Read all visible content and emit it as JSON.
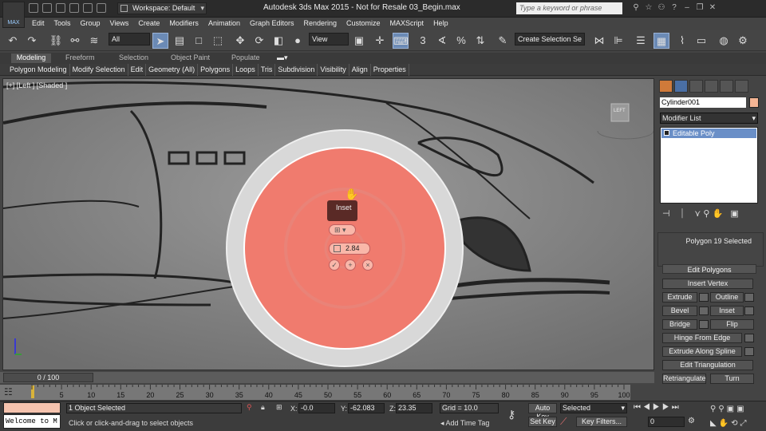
{
  "app": {
    "logo": "MAX",
    "title": "Autodesk 3ds Max  2015  - Not for Resale   03_Begin.max",
    "workspace": "Workspace: Default",
    "search_placeholder": "Type a keyword or phrase"
  },
  "menu": [
    "Edit",
    "Tools",
    "Group",
    "Views",
    "Create",
    "Modifiers",
    "Animation",
    "Graph Editors",
    "Rendering",
    "Customize",
    "MAXScript",
    "Help"
  ],
  "toolbar": {
    "selection_filter": "All",
    "ref_coord": "View",
    "snap_label": "3",
    "named_selection": "Create Selection Se"
  },
  "ribbon": {
    "tabs": [
      "Modeling",
      "Freeform",
      "Selection",
      "Object Paint",
      "Populate"
    ],
    "panels": [
      "Polygon Modeling",
      "Modify Selection",
      "Edit",
      "Geometry (All)",
      "Polygons",
      "Loops",
      "Tris",
      "Subdivision",
      "Visibility",
      "Align",
      "Properties"
    ]
  },
  "viewport": {
    "label": "[+] [Left ] [Shaded ]",
    "viewcube": "LEFT",
    "caddy": {
      "title": "Inset",
      "value": "2.84"
    }
  },
  "command_panel": {
    "object_name": "Cylinder001",
    "object_color": "#f4b594",
    "modifier_list": "Modifier List",
    "stack_item": "Editable Poly",
    "selection_info": "Polygon 19 Selected",
    "rollout_title": "Edit Polygons",
    "buttons": {
      "insert_vertex": "Insert Vertex",
      "extrude": "Extrude",
      "outline": "Outline",
      "bevel": "Bevel",
      "inset": "Inset",
      "bridge": "Bridge",
      "flip": "Flip",
      "hinge": "Hinge From Edge",
      "extrude_spline": "Extrude Along Spline",
      "edit_tri": "Edit Triangulation",
      "retriangulate": "Retriangulate",
      "turn": "Turn"
    }
  },
  "timeline": {
    "slider": "0 / 100",
    "ticks": [
      "0",
      "5",
      "10",
      "15",
      "20",
      "25",
      "30",
      "35",
      "40",
      "45",
      "50",
      "55",
      "60",
      "65",
      "70",
      "75",
      "80",
      "85",
      "90",
      "95",
      "100"
    ]
  },
  "status": {
    "listener": "Welcome to M",
    "selection": "1 Object Selected",
    "prompt": "Click or click-and-drag to select objects",
    "x_label": "X:",
    "x": "-0.0",
    "y_label": "Y:",
    "y": "-62.083",
    "z_label": "Z:",
    "z": "23.35",
    "grid": "Grid = 10.0",
    "add_time_tag": "Add Time Tag",
    "auto_key": "Auto Key",
    "set_key": "Set Key",
    "key_mode": "Selected",
    "key_filters": "Key Filters...",
    "frame": "0"
  }
}
